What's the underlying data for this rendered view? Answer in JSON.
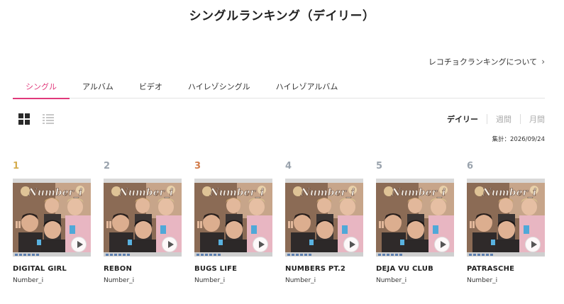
{
  "page_title": "シングルランキング（デイリー）",
  "about_link": {
    "label": "レコチョクランキングについて",
    "icon": "chevron-right-icon"
  },
  "tabs": [
    {
      "label": "シングル",
      "active": true
    },
    {
      "label": "アルバム"
    },
    {
      "label": "ビデオ"
    },
    {
      "label": "ハイレゾシングル"
    },
    {
      "label": "ハイレゾアルバム"
    }
  ],
  "view_toggle": {
    "grid_icon": "grid-view-icon",
    "list_icon": "list-view-icon",
    "selected": "grid"
  },
  "period": {
    "daily": "デイリー",
    "weekly": "週間",
    "monthly": "月間",
    "selected": "daily"
  },
  "tally": "集計：2026/09/24",
  "rank_colors": {
    "1": "#d5ad4f",
    "2": "#9aa3ad",
    "3": "#d27c4a",
    "other": "#9aa3ad"
  },
  "accent_color": "#e0397b",
  "jacket_text": "Number_i",
  "items": [
    {
      "rank": "1",
      "title": "DIGITAL GIRL",
      "artist": "Number_i"
    },
    {
      "rank": "2",
      "title": "REBON",
      "artist": "Number_i"
    },
    {
      "rank": "3",
      "title": "BUGS LIFE",
      "artist": "Number_i"
    },
    {
      "rank": "4",
      "title": "NUMBERS PT.2",
      "artist": "Number_i"
    },
    {
      "rank": "5",
      "title": "DEJA VU CLUB",
      "artist": "Number_i"
    },
    {
      "rank": "6",
      "title": "PATRASCHE",
      "artist": "Number_i"
    }
  ]
}
